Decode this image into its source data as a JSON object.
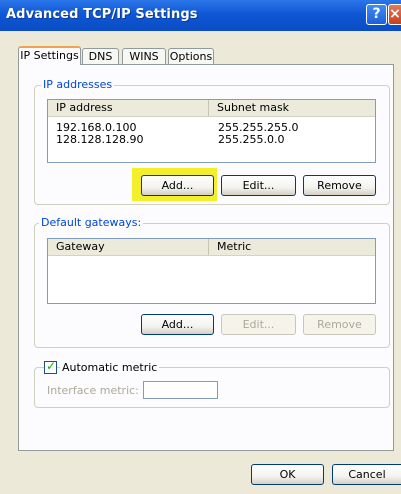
{
  "window": {
    "title": "Advanced TCP/IP Settings"
  },
  "titlebar": {
    "help_label": "?",
    "close_label": "×"
  },
  "tabs": [
    {
      "label": "IP Settings",
      "active": true
    },
    {
      "label": "DNS",
      "active": false
    },
    {
      "label": "WINS",
      "active": false
    },
    {
      "label": "Options",
      "active": false
    }
  ],
  "ip_addresses": {
    "legend": "IP addresses",
    "headers": [
      "IP address",
      "Subnet mask"
    ],
    "rows": [
      [
        "192.168.0.100",
        "255.255.255.0"
      ],
      [
        "128.128.128.90",
        "255.255.0.0"
      ]
    ],
    "add_label": "Add...",
    "edit_label": "Edit...",
    "remove_label": "Remove"
  },
  "default_gateways": {
    "legend": "Default gateways:",
    "headers": [
      "Gateway",
      "Metric"
    ],
    "add_label": "Add...",
    "edit_label": "Edit...",
    "remove_label": "Remove"
  },
  "automatic_metric": {
    "label": "Automatic metric",
    "checked": true
  },
  "interface_metric": {
    "label": "Interface metric:",
    "value": ""
  },
  "footer": {
    "ok_label": "OK",
    "cancel_label": "Cancel"
  },
  "colors": {
    "title_bar": "#0f57d6",
    "highlight": "#f4ef2b",
    "group_legend": "#0046d5"
  }
}
